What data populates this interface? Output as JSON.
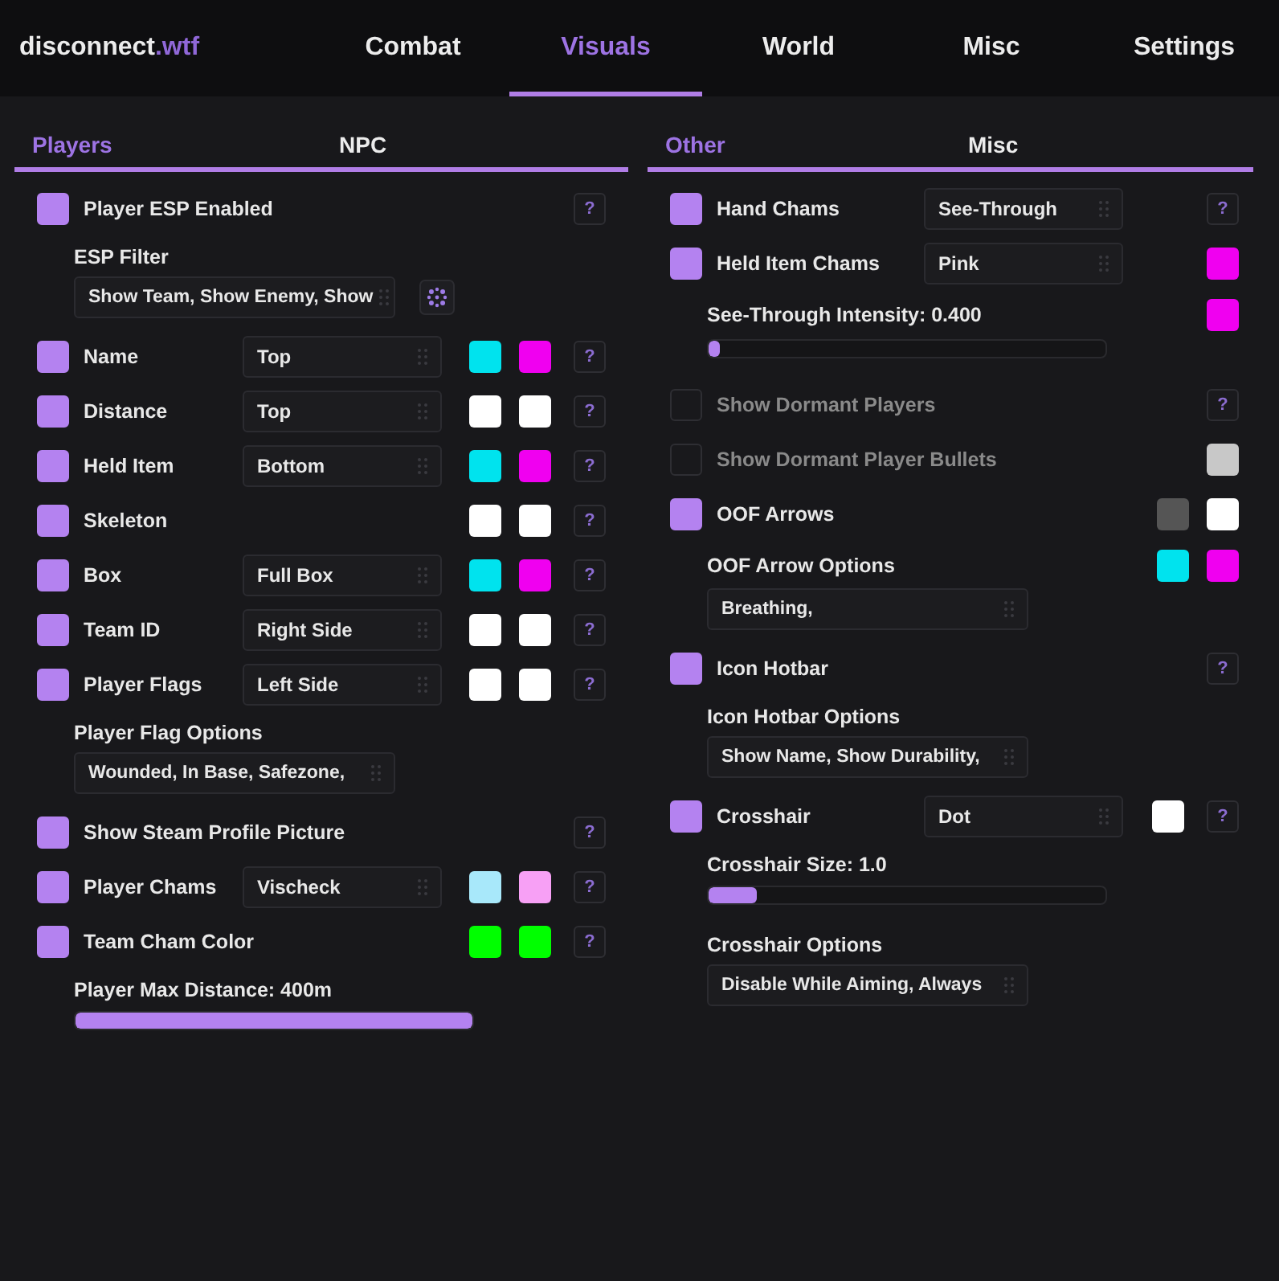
{
  "header": {
    "logo": {
      "text": "disconnect",
      "accent": ".wtf"
    },
    "tabs": [
      {
        "label": "Combat",
        "selected": false
      },
      {
        "label": "Visuals",
        "selected": true
      },
      {
        "label": "World",
        "selected": false
      },
      {
        "label": "Misc",
        "selected": false
      },
      {
        "label": "Settings",
        "selected": false
      }
    ]
  },
  "panels": [
    {
      "tabs": [
        {
          "label": "Players",
          "selected": true
        },
        {
          "label": "NPC",
          "selected": false
        }
      ],
      "items": [
        {
          "kind": "toggle",
          "label": "Player ESP Enabled",
          "checked": true,
          "help": "?"
        },
        {
          "kind": "multiselect",
          "label": "ESP Filter",
          "value": "Show Team, Show Enemy, Show",
          "spinner": true
        },
        {
          "kind": "toggle",
          "label": "Name",
          "checked": true,
          "dropdown": "Top",
          "swatches": [
            {
              "color": "#00e3ee"
            },
            {
              "color": "#f000f0"
            }
          ],
          "help": "?"
        },
        {
          "kind": "toggle",
          "label": "Distance",
          "checked": true,
          "dropdown": "Top",
          "swatches": [
            {
              "color": "#ffffff"
            },
            {
              "color": "#ffffff"
            }
          ],
          "help": "?"
        },
        {
          "kind": "toggle",
          "label": "Held Item",
          "checked": true,
          "dropdown": "Bottom",
          "swatches": [
            {
              "color": "#00e3ee"
            },
            {
              "color": "#f000f0"
            }
          ],
          "help": "?"
        },
        {
          "kind": "toggle",
          "label": "Skeleton",
          "checked": true,
          "swatches": [
            {
              "color": "#ffffff"
            },
            {
              "color": "#ffffff"
            }
          ],
          "help": "?"
        },
        {
          "kind": "toggle",
          "label": "Box",
          "checked": true,
          "dropdown": "Full Box",
          "swatches": [
            {
              "color": "#00e3ee"
            },
            {
              "color": "#f000f0"
            }
          ],
          "help": "?"
        },
        {
          "kind": "toggle",
          "label": "Team ID",
          "checked": true,
          "dropdown": "Right Side",
          "swatches": [
            {
              "color": "#ffffff"
            },
            {
              "color": "#ffffff"
            }
          ],
          "help": "?"
        },
        {
          "kind": "toggle",
          "label": "Player Flags",
          "checked": true,
          "dropdown": "Left Side",
          "swatches": [
            {
              "color": "#ffffff"
            },
            {
              "color": "#ffffff"
            }
          ],
          "help": "?"
        },
        {
          "kind": "multiselect",
          "label": "Player Flag Options",
          "value": "Wounded, In Base, Safezone,"
        },
        {
          "kind": "toggle",
          "label": "Show Steam Profile Picture",
          "checked": true,
          "help": "?"
        },
        {
          "kind": "toggle",
          "label": "Player Chams",
          "checked": true,
          "dropdown": "Vischeck",
          "swatches": [
            {
              "color": "#a8e8fa"
            },
            {
              "color": "#f7a0f5"
            }
          ],
          "help": "?"
        },
        {
          "kind": "toggle",
          "label": "Team Cham Color",
          "checked": true,
          "swatches": [
            {
              "color": "#00ff00"
            },
            {
              "color": "#00ff00"
            }
          ],
          "help": "?"
        },
        {
          "kind": "slider",
          "label": "Player Max Distance: 400m",
          "level": 1
        }
      ]
    },
    {
      "tabs": [
        {
          "label": "Other",
          "selected": true
        },
        {
          "label": "Misc",
          "selected": false
        }
      ],
      "items": [
        {
          "kind": "toggle",
          "label": "Hand Chams",
          "checked": true,
          "dropdown": "See-Through",
          "help": "?"
        },
        {
          "kind": "toggle",
          "label": "Held Item Chams",
          "checked": true,
          "dropdown": "Pink",
          "swatches": [
            {
              "color": "#f000f0"
            }
          ]
        },
        {
          "kind": "slider",
          "label": "See-Through Intensity: 0.400",
          "level": 0.03,
          "swatches": [
            {
              "color": "#f000f0"
            }
          ]
        },
        {
          "kind": "toggle",
          "label": "Show Dormant Players",
          "checked": false,
          "help": "?"
        },
        {
          "kind": "toggle",
          "label": "Show Dormant Player Bullets",
          "checked": false,
          "swatches": [
            {
              "color": "#c8c8c8"
            }
          ]
        },
        {
          "kind": "toggle",
          "label": "OOF Arrows",
          "checked": true,
          "swatches": [
            {
              "color": "#555555"
            },
            {
              "color": "#ffffff"
            }
          ]
        },
        {
          "kind": "multiselect",
          "label": "OOF Arrow Options",
          "value": "Breathing,",
          "swatches": [
            {
              "color": "#00e3ee"
            },
            {
              "color": "#f000f0"
            }
          ]
        },
        {
          "kind": "toggle",
          "label": "Icon Hotbar",
          "checked": true,
          "help": "?"
        },
        {
          "kind": "multiselect",
          "label": "Icon Hotbar Options",
          "value": "Show Name, Show Durability,"
        },
        {
          "kind": "toggle",
          "label": "Crosshair",
          "checked": true,
          "dropdown": "Dot",
          "swatches": [
            {
              "color": "#ffffff"
            }
          ],
          "help": "?"
        },
        {
          "kind": "slider",
          "label": "Crosshair Size: 1.0",
          "level": 0.12
        },
        {
          "kind": "multiselect",
          "label": "Crosshair Options",
          "value": "Disable While Aiming, Always"
        }
      ]
    }
  ]
}
